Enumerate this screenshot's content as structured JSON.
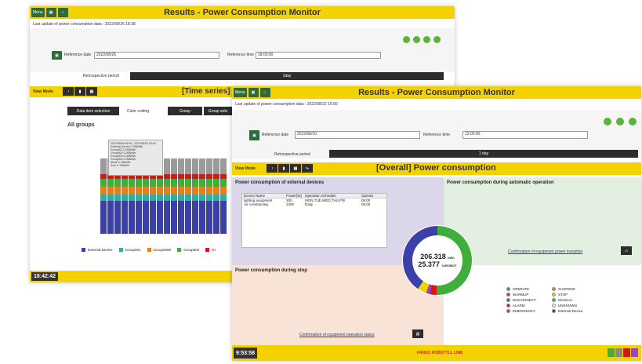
{
  "back_window": {
    "title": "Results - Power Consumption Monitor",
    "top_buttons": [
      "Menu",
      "",
      ""
    ],
    "last_update": "Last update of power consumption data : 2022/08/26 18:38",
    "reference_date_label": "Reference date",
    "reference_date": "2022/08/26",
    "reference_time_label": "Reference time",
    "reference_time": "18:00:00",
    "retro_label": "Retrospective period",
    "retro_value": "1day",
    "view_mode_label": "View Mode",
    "tab_title": "[Time series]",
    "data_item_btn": "Data item selection",
    "color_coding_label": "Color coding",
    "group_select": "Group",
    "group_btn": "Group sele",
    "all_groups": "All groups",
    "tooltip_lines": [
      "2022/08/26 06:00 - 2022/08/26 09:00",
      "External Device  0.784kWh",
      "Group001  0.008kWh",
      "Group002  0.008kWh",
      "Group003  0.008kWh",
      "Group004  0.008kWh",
      "Mode  0.784kWh",
      "Sum  0.784kWh"
    ],
    "legend": [
      "External Device",
      "Group001",
      "Group0008",
      "Group003",
      "Gr"
    ],
    "clock": "18:42:42"
  },
  "front_window": {
    "title": "Results - Power Consumption Monitor",
    "top_buttons": [
      "Menu",
      "",
      ""
    ],
    "last_update": "Last update of power consumption data : 2022/08/22 16:50",
    "reference_date_label": "Reference date",
    "reference_date": "2022/08/10",
    "reference_time_label": "Reference time",
    "reference_time": "13:00:00",
    "retro_label": "Retrospective period",
    "retro_value": "1 day",
    "view_mode_label": "View Mode",
    "tab_title": "[Overall] Power consumption",
    "panel_external": "Power consumption of external devices",
    "table_headers": [
      "Device Name",
      "Power(W)",
      "Operation Schedule",
      "Operati"
    ],
    "table_rows": [
      [
        "lighting equipment",
        "300",
        "MON,TUE,WED,THU,FRI",
        "05:00"
      ],
      [
        "Air conditioning",
        "1000",
        "Daily",
        "06:00"
      ]
    ],
    "panel_auto": "Power consumption during automatic operation",
    "panel_stop": "Power consumption during stop",
    "donut_value1": "206.318",
    "donut_unit1": "kWh",
    "donut_value2": "25.377",
    "donut_unit2": "%/ROBOT",
    "link_transition": "Confirmation of equipment power transition",
    "link_status": "Confirmation of equipment operation status",
    "legend": [
      {
        "label": "OPERATE",
        "color": "#3fae3a"
      },
      {
        "label": "WARMUP",
        "color": "#c0392b"
      },
      {
        "label": "DISCONNECT",
        "color": "#6b6b6b"
      },
      {
        "label": "ALARM",
        "color": "#d4171d"
      },
      {
        "label": "EMERGENCY",
        "color": "#9b44c5"
      },
      {
        "label": "SUSPEND",
        "color": "#e87e1c"
      },
      {
        "label": "STOP",
        "color": "#f4d200"
      },
      {
        "label": "MANUAL",
        "color": "#2bb0a8"
      },
      {
        "label": "UNKNOWN",
        "color": "#ffffff"
      },
      {
        "label": "External Device",
        "color": "#3b3fa8"
      }
    ],
    "clock": "9:53:58",
    "brand": "FANUC ROBOTTLL LINK"
  },
  "colors": {
    "accent": "#f4d200",
    "green": "#2f6a3a"
  }
}
